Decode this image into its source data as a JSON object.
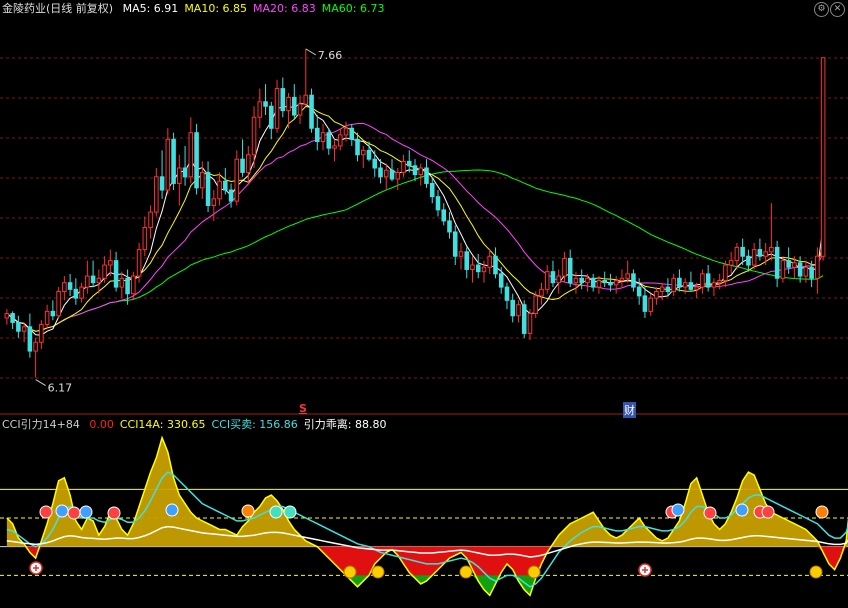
{
  "header": {
    "title": "金陵药业(日线 前复权)",
    "ma": [
      {
        "label": "MA5: 6.91",
        "color": "#ffffff"
      },
      {
        "label": "MA10: 6.85",
        "color": "#ffff00"
      },
      {
        "label": "MA20: 6.83",
        "color": "#ff44ff"
      },
      {
        "label": "MA60: 6.73",
        "color": "#00ff00"
      }
    ],
    "controls": [
      "gear-icon",
      "close-icon"
    ]
  },
  "indicator_header": {
    "name": "CCI引力14+84",
    "items": [
      {
        "label": "0.00",
        "color": "#ff2020"
      },
      {
        "label": "CCI14A: 330.65",
        "color": "#ffff00"
      },
      {
        "label": "CCI买卖: 156.86",
        "color": "#40e0e0"
      },
      {
        "label": "引力乖离: 88.80",
        "color": "#ffffff"
      }
    ]
  },
  "markers": {
    "s_label": "S",
    "cai_label": "财"
  },
  "chart_data": [
    {
      "type": "candlestick",
      "price_high_label": "7.66",
      "price_low_label": "6.17",
      "ylim": [
        6.05,
        7.8
      ],
      "colors": {
        "up": "#ff3030",
        "down": "#40e0e0",
        "ma5": "#ffffff",
        "ma10": "#ffff00",
        "ma20": "#ff44ff",
        "ma60": "#00ff00"
      },
      "ohlc": [
        [
          6.44,
          6.48,
          6.41,
          6.46
        ],
        [
          6.46,
          6.47,
          6.39,
          6.42
        ],
        [
          6.42,
          6.45,
          6.35,
          6.38
        ],
        [
          6.38,
          6.42,
          6.33,
          6.4
        ],
        [
          6.4,
          6.46,
          6.26,
          6.29
        ],
        [
          6.29,
          6.35,
          6.17,
          6.33
        ],
        [
          6.33,
          6.43,
          6.3,
          6.41
        ],
        [
          6.41,
          6.5,
          6.39,
          6.47
        ],
        [
          6.47,
          6.52,
          6.43,
          6.45
        ],
        [
          6.45,
          6.58,
          6.44,
          6.56
        ],
        [
          6.56,
          6.63,
          6.52,
          6.6
        ],
        [
          6.6,
          6.64,
          6.54,
          6.57
        ],
        [
          6.57,
          6.62,
          6.5,
          6.53
        ],
        [
          6.53,
          6.6,
          6.51,
          6.58
        ],
        [
          6.58,
          6.7,
          6.55,
          6.63
        ],
        [
          6.63,
          6.7,
          6.58,
          6.6
        ],
        [
          6.6,
          6.66,
          6.55,
          6.62
        ],
        [
          6.62,
          6.72,
          6.6,
          6.68
        ],
        [
          6.68,
          6.75,
          6.63,
          6.7
        ],
        [
          6.7,
          6.74,
          6.56,
          6.58
        ],
        [
          6.58,
          6.65,
          6.53,
          6.62
        ],
        [
          6.62,
          6.66,
          6.5,
          6.55
        ],
        [
          6.55,
          6.65,
          6.52,
          6.63
        ],
        [
          6.63,
          6.78,
          6.6,
          6.75
        ],
        [
          6.75,
          6.9,
          6.72,
          6.85
        ],
        [
          6.85,
          6.95,
          6.8,
          6.92
        ],
        [
          6.92,
          7.12,
          6.9,
          7.08
        ],
        [
          7.08,
          7.2,
          6.98,
          7.02
        ],
        [
          7.02,
          7.3,
          7.0,
          7.25
        ],
        [
          7.25,
          7.28,
          7.02,
          7.05
        ],
        [
          7.05,
          7.18,
          6.95,
          7.12
        ],
        [
          7.12,
          7.22,
          7.04,
          7.08
        ],
        [
          7.08,
          7.35,
          7.05,
          7.28
        ],
        [
          7.28,
          7.32,
          7.0,
          7.03
        ],
        [
          7.03,
          7.15,
          6.98,
          7.1
        ],
        [
          7.1,
          7.15,
          6.92,
          6.95
        ],
        [
          6.95,
          7.02,
          6.88,
          6.98
        ],
        [
          6.98,
          7.1,
          6.95,
          7.06
        ],
        [
          7.06,
          7.12,
          7.0,
          7.02
        ],
        [
          7.02,
          7.05,
          6.94,
          6.97
        ],
        [
          6.97,
          7.2,
          6.95,
          7.16
        ],
        [
          7.16,
          7.25,
          7.08,
          7.1
        ],
        [
          7.1,
          7.22,
          7.05,
          7.18
        ],
        [
          7.18,
          7.4,
          7.12,
          7.35
        ],
        [
          7.35,
          7.48,
          7.3,
          7.42
        ],
        [
          7.42,
          7.5,
          7.36,
          7.4
        ],
        [
          7.4,
          7.42,
          7.25,
          7.3
        ],
        [
          7.3,
          7.52,
          7.28,
          7.48
        ],
        [
          7.48,
          7.53,
          7.35,
          7.38
        ],
        [
          7.38,
          7.46,
          7.3,
          7.44
        ],
        [
          7.44,
          7.5,
          7.34,
          7.36
        ],
        [
          7.36,
          7.45,
          7.32,
          7.41
        ],
        [
          7.41,
          7.66,
          7.4,
          7.45
        ],
        [
          7.45,
          7.48,
          7.28,
          7.3
        ],
        [
          7.3,
          7.36,
          7.2,
          7.24
        ],
        [
          7.24,
          7.32,
          7.2,
          7.28
        ],
        [
          7.28,
          7.3,
          7.18,
          7.21
        ],
        [
          7.21,
          7.25,
          7.15,
          7.22
        ],
        [
          7.22,
          7.3,
          7.2,
          7.27
        ],
        [
          7.27,
          7.33,
          7.24,
          7.3
        ],
        [
          7.3,
          7.32,
          7.22,
          7.25
        ],
        [
          7.25,
          7.28,
          7.15,
          7.18
        ],
        [
          7.18,
          7.22,
          7.12,
          7.2
        ],
        [
          7.2,
          7.24,
          7.15,
          7.16
        ],
        [
          7.16,
          7.2,
          7.08,
          7.12
        ],
        [
          7.12,
          7.16,
          7.05,
          7.08
        ],
        [
          7.08,
          7.14,
          7.02,
          7.11
        ],
        [
          7.11,
          7.16,
          7.06,
          7.07
        ],
        [
          7.07,
          7.12,
          7.02,
          7.1
        ],
        [
          7.1,
          7.18,
          7.08,
          7.15
        ],
        [
          7.15,
          7.2,
          7.1,
          7.13
        ],
        [
          7.13,
          7.16,
          7.06,
          7.09
        ],
        [
          7.09,
          7.14,
          7.04,
          7.12
        ],
        [
          7.12,
          7.16,
          7.03,
          7.05
        ],
        [
          7.05,
          7.08,
          6.96,
          6.99
        ],
        [
          6.99,
          7.02,
          6.9,
          6.93
        ],
        [
          6.93,
          6.96,
          6.86,
          6.88
        ],
        [
          6.88,
          6.92,
          6.8,
          6.83
        ],
        [
          6.83,
          6.86,
          6.68,
          6.72
        ],
        [
          6.72,
          6.78,
          6.66,
          6.74
        ],
        [
          6.74,
          6.76,
          6.62,
          6.66
        ],
        [
          6.66,
          6.72,
          6.6,
          6.68
        ],
        [
          6.68,
          6.73,
          6.62,
          6.65
        ],
        [
          6.65,
          6.7,
          6.6,
          6.67
        ],
        [
          6.67,
          6.75,
          6.64,
          6.72
        ],
        [
          6.72,
          6.76,
          6.62,
          6.64
        ],
        [
          6.64,
          6.67,
          6.55,
          6.58
        ],
        [
          6.58,
          6.6,
          6.48,
          6.52
        ],
        [
          6.52,
          6.55,
          6.42,
          6.45
        ],
        [
          6.45,
          6.52,
          6.42,
          6.5
        ],
        [
          6.5,
          6.52,
          6.35,
          6.37
        ],
        [
          6.37,
          6.48,
          6.34,
          6.46
        ],
        [
          6.46,
          6.56,
          6.44,
          6.54
        ],
        [
          6.54,
          6.6,
          6.5,
          6.57
        ],
        [
          6.57,
          6.68,
          6.55,
          6.65
        ],
        [
          6.65,
          6.7,
          6.58,
          6.6
        ],
        [
          6.6,
          6.66,
          6.55,
          6.63
        ],
        [
          6.63,
          6.74,
          6.6,
          6.71
        ],
        [
          6.71,
          6.75,
          6.58,
          6.6
        ],
        [
          6.6,
          6.65,
          6.55,
          6.62
        ],
        [
          6.62,
          6.66,
          6.57,
          6.6
        ],
        [
          6.6,
          6.64,
          6.56,
          6.62
        ],
        [
          6.62,
          6.64,
          6.56,
          6.58
        ],
        [
          6.58,
          6.63,
          6.55,
          6.61
        ],
        [
          6.61,
          6.65,
          6.58,
          6.6
        ],
        [
          6.6,
          6.64,
          6.56,
          6.59
        ],
        [
          6.59,
          6.63,
          6.55,
          6.61
        ],
        [
          6.61,
          6.66,
          6.58,
          6.62
        ],
        [
          6.62,
          6.7,
          6.6,
          6.64
        ],
        [
          6.64,
          6.66,
          6.56,
          6.58
        ],
        [
          6.58,
          6.62,
          6.5,
          6.54
        ],
        [
          6.54,
          6.58,
          6.44,
          6.47
        ],
        [
          6.47,
          6.55,
          6.45,
          6.53
        ],
        [
          6.53,
          6.58,
          6.5,
          6.56
        ],
        [
          6.56,
          6.6,
          6.52,
          6.58
        ],
        [
          6.58,
          6.62,
          6.54,
          6.56
        ],
        [
          6.56,
          6.64,
          6.54,
          6.62
        ],
        [
          6.62,
          6.66,
          6.56,
          6.58
        ],
        [
          6.58,
          6.62,
          6.55,
          6.6
        ],
        [
          6.6,
          6.65,
          6.56,
          6.57
        ],
        [
          6.57,
          6.6,
          6.53,
          6.58
        ],
        [
          6.58,
          6.66,
          6.55,
          6.64
        ],
        [
          6.64,
          6.68,
          6.56,
          6.58
        ],
        [
          6.58,
          6.62,
          6.54,
          6.6
        ],
        [
          6.6,
          6.64,
          6.57,
          6.61
        ],
        [
          6.61,
          6.7,
          6.58,
          6.68
        ],
        [
          6.68,
          6.74,
          6.64,
          6.7
        ],
        [
          6.7,
          6.78,
          6.66,
          6.76
        ],
        [
          6.76,
          6.8,
          6.68,
          6.72
        ],
        [
          6.72,
          6.75,
          6.65,
          6.68
        ],
        [
          6.68,
          6.78,
          6.66,
          6.75
        ],
        [
          6.75,
          6.8,
          6.7,
          6.72
        ],
        [
          6.72,
          6.78,
          6.68,
          6.74
        ],
        [
          6.74,
          6.96,
          6.7,
          6.76
        ],
        [
          6.76,
          6.79,
          6.58,
          6.62
        ],
        [
          6.62,
          6.72,
          6.6,
          6.7
        ],
        [
          6.7,
          6.76,
          6.64,
          6.67
        ],
        [
          6.67,
          6.72,
          6.62,
          6.69
        ],
        [
          6.69,
          6.72,
          6.6,
          6.63
        ],
        [
          6.63,
          6.7,
          6.6,
          6.67
        ],
        [
          6.67,
          6.7,
          6.58,
          6.62
        ],
        [
          6.62,
          6.76,
          6.55,
          6.72
        ],
        [
          6.72,
          7.62,
          6.7,
          7.62
        ]
      ]
    },
    {
      "type": "area",
      "name": "CCI引力14+84",
      "ylim": [
        -200,
        400
      ],
      "levels": [
        200,
        100,
        -100
      ],
      "cci14a": [
        100,
        80,
        30,
        10,
        -20,
        -40,
        20,
        80,
        150,
        230,
        240,
        180,
        90,
        60,
        100,
        90,
        40,
        70,
        120,
        100,
        60,
        40,
        80,
        140,
        200,
        260,
        310,
        380,
        330,
        240,
        180,
        150,
        120,
        100,
        90,
        80,
        70,
        60,
        60,
        50,
        40,
        70,
        90,
        120,
        140,
        170,
        180,
        160,
        130,
        90,
        60,
        40,
        20,
        10,
        0,
        -20,
        -40,
        -60,
        -80,
        -100,
        -120,
        -140,
        -120,
        -100,
        -60,
        -40,
        -20,
        -10,
        -30,
        -60,
        -90,
        -110,
        -130,
        -120,
        -100,
        -80,
        -60,
        -40,
        -30,
        -20,
        -40,
        -80,
        -120,
        -150,
        -170,
        -130,
        -90,
        -60,
        -80,
        -120,
        -150,
        -170,
        -110,
        -60,
        -20,
        10,
        40,
        60,
        80,
        90,
        100,
        110,
        120,
        90,
        60,
        40,
        30,
        40,
        60,
        80,
        100,
        70,
        50,
        30,
        20,
        30,
        60,
        90,
        150,
        220,
        240,
        180,
        120,
        80,
        60,
        80,
        120,
        170,
        230,
        260,
        250,
        200,
        150,
        120,
        110,
        100,
        90,
        80,
        70,
        60,
        40,
        20,
        -20,
        -60,
        -80,
        -40,
        20,
        200,
        330
      ],
      "cci_buysell": [
        60,
        55,
        40,
        25,
        10,
        0,
        10,
        30,
        60,
        100,
        130,
        140,
        120,
        100,
        100,
        100,
        90,
        85,
        95,
        100,
        95,
        85,
        85,
        100,
        125,
        160,
        200,
        240,
        260,
        250,
        230,
        210,
        190,
        170,
        150,
        140,
        130,
        120,
        110,
        100,
        90,
        90,
        95,
        100,
        110,
        120,
        130,
        140,
        140,
        130,
        120,
        110,
        100,
        90,
        80,
        70,
        60,
        50,
        40,
        30,
        20,
        10,
        5,
        0,
        -10,
        -20,
        -25,
        -30,
        -35,
        -40,
        -45,
        -50,
        -55,
        -60,
        -60,
        -60,
        -55,
        -50,
        -45,
        -40,
        -45,
        -55,
        -70,
        -90,
        -110,
        -120,
        -110,
        -100,
        -100,
        -110,
        -125,
        -140,
        -130,
        -110,
        -80,
        -50,
        -20,
        0,
        20,
        35,
        50,
        60,
        70,
        70,
        65,
        60,
        55,
        55,
        60,
        65,
        70,
        70,
        65,
        60,
        55,
        55,
        60,
        70,
        90,
        120,
        140,
        140,
        130,
        115,
        100,
        100,
        110,
        130,
        150,
        170,
        180,
        180,
        170,
        160,
        150,
        140,
        130,
        120,
        110,
        100,
        90,
        80,
        60,
        40,
        30,
        30,
        50,
        110,
        156.86
      ],
      "gravity_bias": [
        20,
        18,
        15,
        12,
        10,
        8,
        10,
        14,
        20,
        28,
        35,
        38,
        36,
        32,
        30,
        29,
        27,
        26,
        28,
        30,
        30,
        28,
        28,
        32,
        38,
        46,
        56,
        66,
        70,
        68,
        64,
        60,
        56,
        52,
        48,
        46,
        44,
        42,
        40,
        38,
        36,
        36,
        38,
        40,
        44,
        48,
        50,
        50,
        48,
        44,
        40,
        36,
        32,
        28,
        24,
        20,
        16,
        12,
        8,
        4,
        0,
        -4,
        -6,
        -8,
        -10,
        -12,
        -12,
        -12,
        -14,
        -16,
        -18,
        -20,
        -22,
        -22,
        -22,
        -20,
        -18,
        -16,
        -14,
        -12,
        -14,
        -18,
        -22,
        -26,
        -30,
        -30,
        -28,
        -26,
        -26,
        -28,
        -32,
        -36,
        -34,
        -30,
        -24,
        -18,
        -12,
        -6,
        0,
        6,
        10,
        14,
        16,
        16,
        15,
        14,
        13,
        13,
        14,
        15,
        16,
        16,
        15,
        14,
        13,
        13,
        14,
        16,
        20,
        26,
        30,
        30,
        28,
        25,
        22,
        22,
        24,
        28,
        32,
        36,
        38,
        38,
        36,
        34,
        32,
        30,
        28,
        26,
        24,
        22,
        20,
        18,
        14,
        10,
        8,
        8,
        12,
        40,
        88.8
      ]
    }
  ]
}
